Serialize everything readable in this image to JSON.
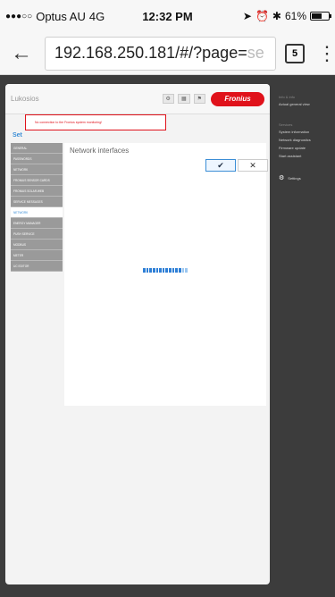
{
  "status_bar": {
    "carrier": "Optus AU",
    "network": "4G",
    "time": "12:32 PM",
    "battery": "61%",
    "battery_level": 0.61
  },
  "browser": {
    "url_main": "192.168.250.181/#/?page=",
    "url_faded": "se",
    "tab_count": "5"
  },
  "page": {
    "site_name": "Lukosios",
    "logo_text": "Fronius",
    "alert_text": "No connection to the Fronius system monitoring!",
    "section_label": "Set",
    "sidebar": [
      "GENERAL",
      "PASSWORDS",
      "NETWORK",
      "FRONIUS SENSOR CARDS",
      "FRONIUS SOLAR.WEB",
      "SERVICE MESSAGES",
      "NETWORK",
      "ENERGY MANAGER",
      "PUSH SERVICE",
      "MODBUS",
      "METER",
      "UC EDITOR"
    ],
    "active_sidebar_index": 6,
    "main_title": "Network interfaces",
    "ok_icon": "checkmark-icon",
    "cancel_icon": "close-icon",
    "spinner_progress": 0.8
  },
  "right_panel": {
    "heading1": "Info & info",
    "item1": "Actual general view",
    "heading2": "Services",
    "items": [
      "System information",
      "Network diagnostics",
      "Firmware update",
      "Start assistant"
    ],
    "settings_label": "Settings"
  }
}
